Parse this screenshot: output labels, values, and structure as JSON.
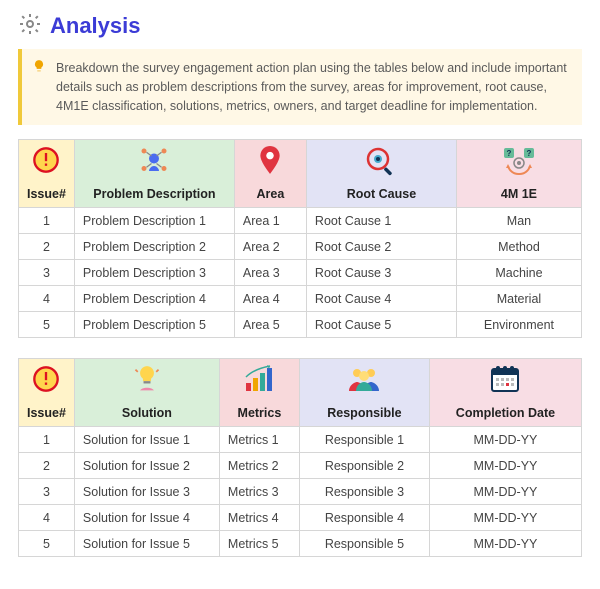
{
  "title": "Analysis",
  "callout": "Breakdown the survey engagement action plan using the tables below and include important details such as problem descriptions from the survey, areas for improvement, root cause, 4M1E classification, solutions, metrics, owners, and target deadline for implementation.",
  "table1": {
    "headers": {
      "issue": "Issue#",
      "problem": "Problem Description",
      "area": "Area",
      "root": "Root Cause",
      "class": "4M 1E"
    },
    "rows": [
      {
        "issue": "1",
        "problem": "Problem Description 1",
        "area": "Area 1",
        "root": "Root Cause 1",
        "class": "Man"
      },
      {
        "issue": "2",
        "problem": "Problem Description 2",
        "area": "Area 2",
        "root": "Root Cause 2",
        "class": "Method"
      },
      {
        "issue": "3",
        "problem": "Problem Description 3",
        "area": "Area 3",
        "root": "Root Cause 3",
        "class": "Machine"
      },
      {
        "issue": "4",
        "problem": "Problem Description 4",
        "area": "Area 4",
        "root": "Root Cause 4",
        "class": "Material"
      },
      {
        "issue": "5",
        "problem": "Problem Description 5",
        "area": "Area 5",
        "root": "Root Cause 5",
        "class": "Environment"
      }
    ]
  },
  "table2": {
    "headers": {
      "issue": "Issue#",
      "solution": "Solution",
      "metrics": "Metrics",
      "responsible": "Responsible",
      "completion": "Completion Date"
    },
    "rows": [
      {
        "issue": "1",
        "solution": "Solution for Issue 1",
        "metrics": "Metrics 1",
        "responsible": "Responsible 1",
        "completion": "MM-DD-YY"
      },
      {
        "issue": "2",
        "solution": "Solution for Issue 2",
        "metrics": "Metrics 2",
        "responsible": "Responsible 2",
        "completion": "MM-DD-YY"
      },
      {
        "issue": "3",
        "solution": "Solution for Issue 3",
        "metrics": "Metrics 3",
        "responsible": "Responsible 3",
        "completion": "MM-DD-YY"
      },
      {
        "issue": "4",
        "solution": "Solution for Issue 4",
        "metrics": "Metrics 4",
        "responsible": "Responsible 4",
        "completion": "MM-DD-YY"
      },
      {
        "issue": "5",
        "solution": "Solution for Issue 5",
        "metrics": "Metrics 5",
        "responsible": "Responsible 5",
        "completion": "MM-DD-YY"
      }
    ]
  }
}
